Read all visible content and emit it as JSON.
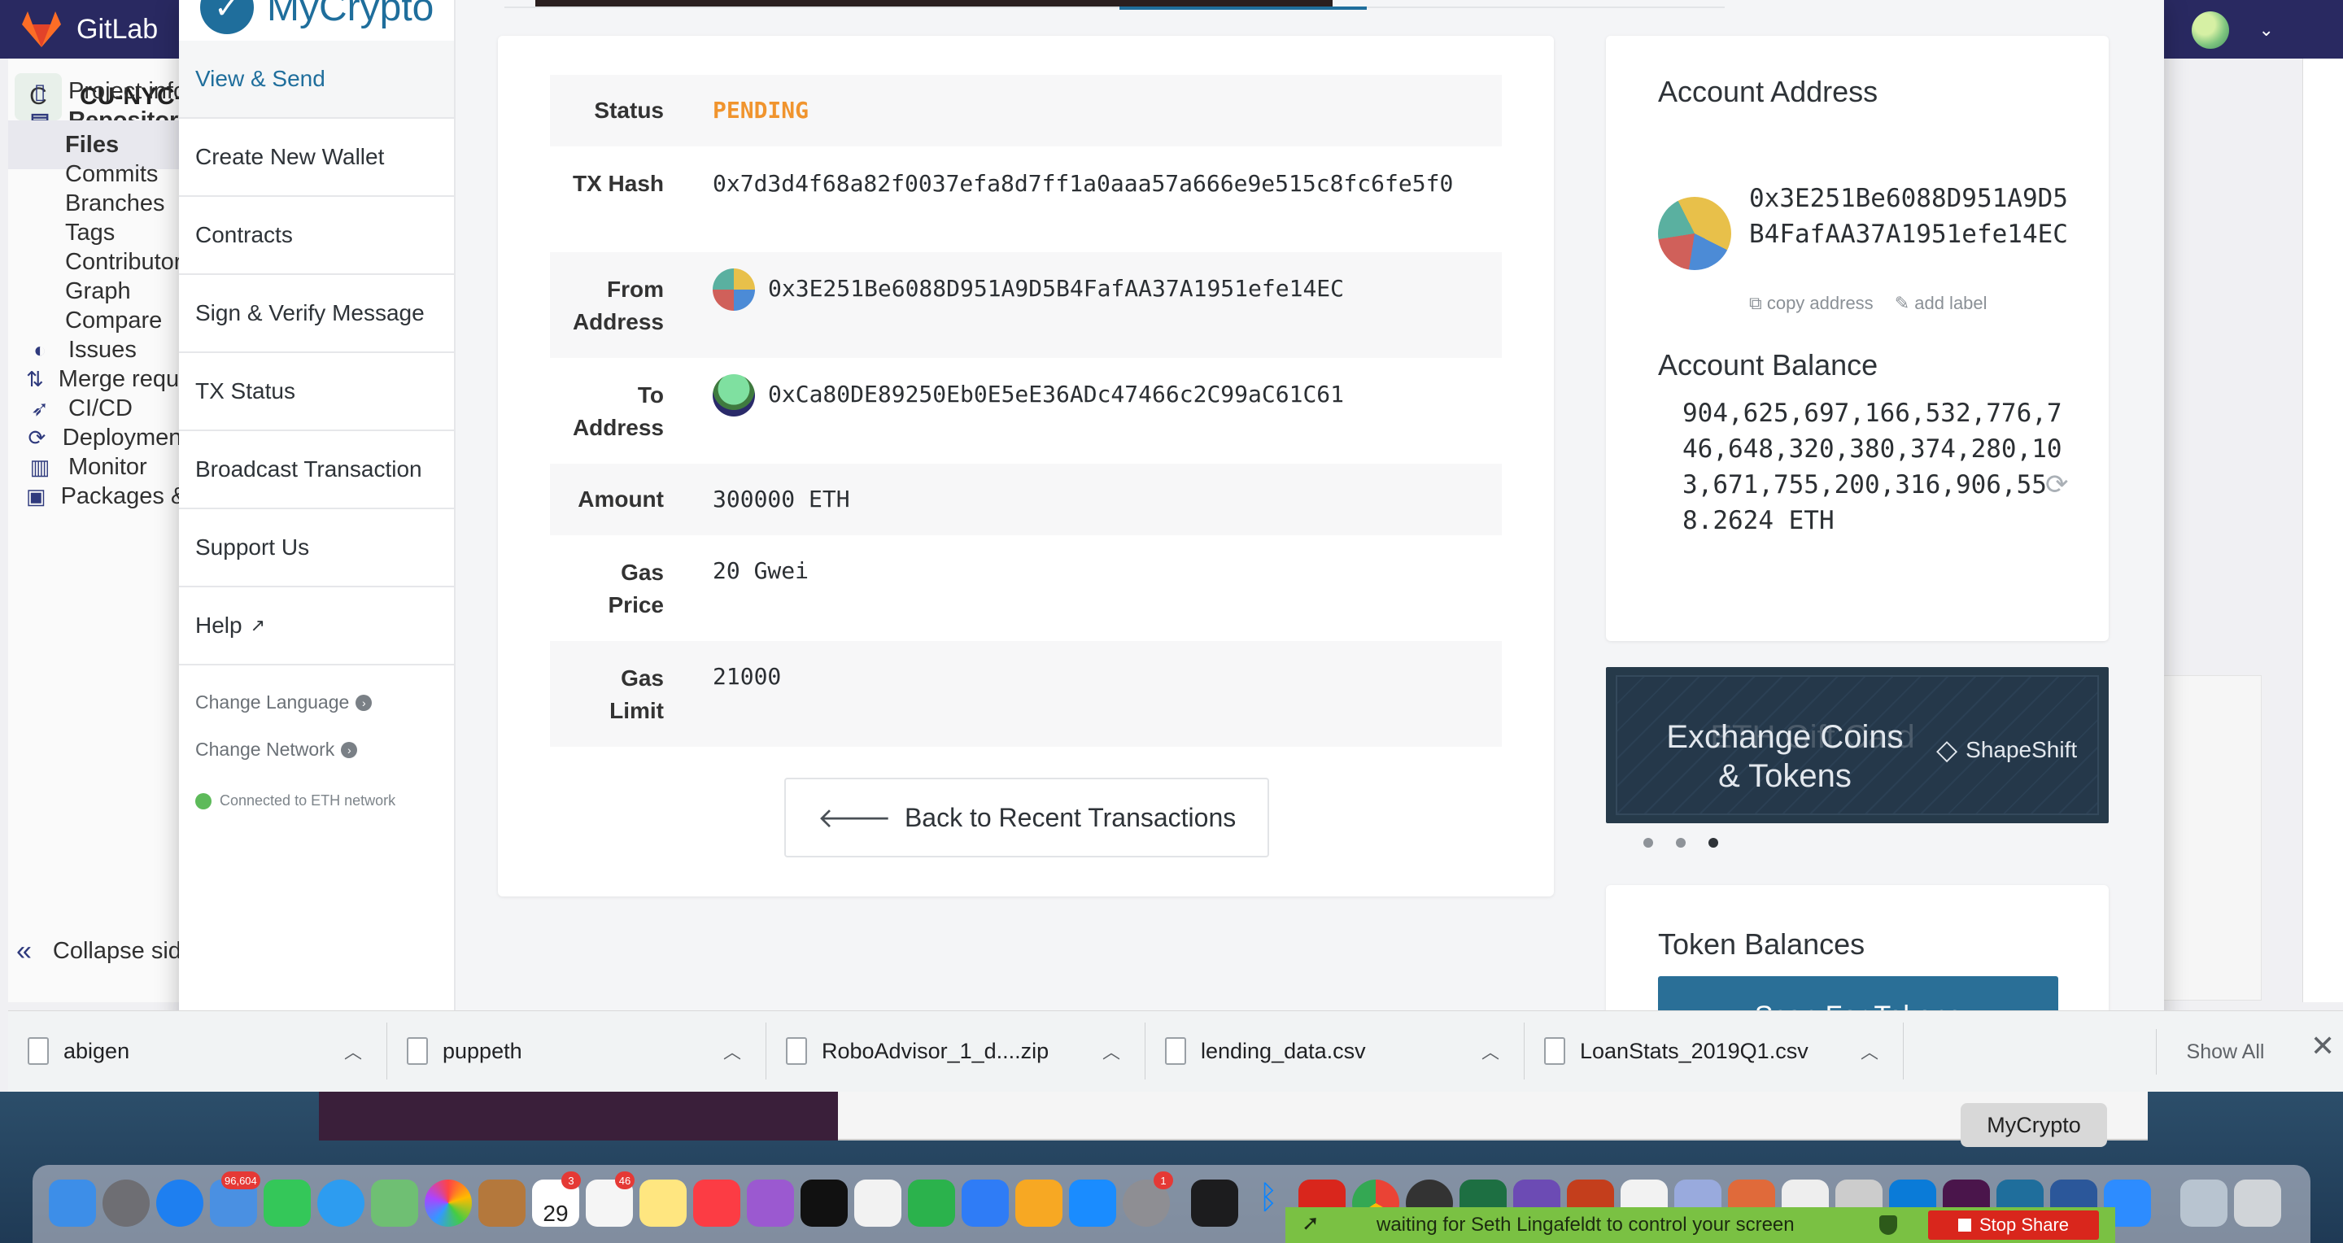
{
  "gitlab": {
    "brand": "GitLab",
    "project_initial": "C",
    "project_name": "CU-NYC-",
    "nav": [
      {
        "label": "Project info",
        "icon": "project-icon"
      },
      {
        "label": "Repository",
        "icon": "repository-icon"
      },
      {
        "label": "Files",
        "icon": ""
      },
      {
        "label": "Commits",
        "icon": ""
      },
      {
        "label": "Branches",
        "icon": ""
      },
      {
        "label": "Tags",
        "icon": ""
      },
      {
        "label": "Contributors",
        "icon": ""
      },
      {
        "label": "Graph",
        "icon": ""
      },
      {
        "label": "Compare",
        "icon": ""
      },
      {
        "label": "Issues",
        "icon": "issues-icon"
      },
      {
        "label": "Merge requests",
        "icon": "merge-request-icon"
      },
      {
        "label": "CI/CD",
        "icon": "rocket-icon"
      },
      {
        "label": "Deployments",
        "icon": "deployments-icon"
      },
      {
        "label": "Monitor",
        "icon": "monitor-icon"
      },
      {
        "label": "Packages & Registries",
        "icon": "package-icon"
      }
    ],
    "collapse_label": "Collapse sidebar"
  },
  "mycrypto": {
    "logo_text": "MyCrypto",
    "nav": [
      {
        "label": "View & Send",
        "active": true
      },
      {
        "label": "Create New Wallet"
      },
      {
        "label": "Contracts"
      },
      {
        "label": "Sign & Verify Message"
      },
      {
        "label": "TX Status"
      },
      {
        "label": "Broadcast Transaction"
      },
      {
        "label": "Support Us"
      },
      {
        "label": "Help"
      }
    ],
    "change_language": "Change Language",
    "change_network": "Change Network",
    "connection_status": "Connected to ETH network",
    "tx": {
      "status_label": "Status",
      "status_value": "PENDING",
      "hash_label": "TX Hash",
      "hash_value": "0x7d3d4f68a82f0037efa8d7ff1a0aaa57a666e9e515c8fc6fe5f0",
      "from_label": "From Address",
      "from_value": "0x3E251Be6088D951A9D5B4FafAA37A1951efe14EC",
      "to_label": "To Address",
      "to_value": "0xCa80DE89250Eb0E5eE36ADc47466c2C99aC61C61",
      "amount_label": "Amount",
      "amount_value": "300000 ETH",
      "gas_price_label": "Gas Price",
      "gas_price_value": "20 Gwei",
      "gas_limit_label": "Gas Limit",
      "gas_limit_value": "21000",
      "back_button": "Back to Recent Transactions"
    },
    "account": {
      "address_title": "Account Address",
      "address": "0x3E251Be6088D951A9D5B4FafAA37A1951efe14EC",
      "copy_address": "copy address",
      "add_label": "add label",
      "balance_title": "Account Balance",
      "balance": "904,625,697,166,532,776,746,648,320,380,374,280,103,671,755,200,316,906,558.2624 ETH"
    },
    "banner": {
      "text": "Exchange Coins & Tokens",
      "ghost_text": "ETH Gift Card",
      "brand": "ShapeShift",
      "active_slide": 3,
      "slide_count": 3
    },
    "tokens": {
      "title": "Token Balances",
      "scan_button": "Scan For Tokens"
    }
  },
  "downloads": {
    "items": [
      "abigen",
      "puppeth",
      "RoboAdvisor_1_d....zip",
      "lending_data.csv",
      "LoanStats_2019Q1.csv"
    ],
    "show_all": "Show All"
  },
  "tooltip": "MyCrypto",
  "screen_share": {
    "message": "waiting for Seth Lingafeldt to control your screen",
    "stop_label": "Stop Share"
  },
  "dock": {
    "mail_badge": "96,604",
    "calendar_day": "29",
    "calendar_badge": "3",
    "reminders_badge": "46",
    "prefs_badge": "1"
  },
  "colors": {
    "accent": "#1f6e9c",
    "pending": "#f0942e",
    "gitlab_header": "#292961",
    "connected": "#5dba5a",
    "share_bar": "#7ac143",
    "stop_share": "#d9261c"
  }
}
